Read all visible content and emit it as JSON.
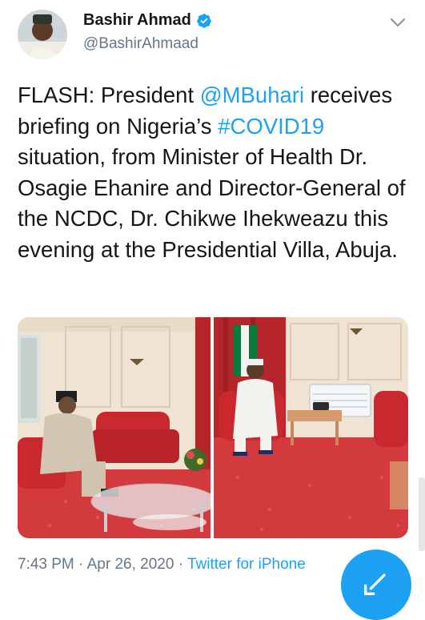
{
  "author": {
    "name": "Bashir Ahmad",
    "handle": "@BashirAhmaad",
    "avatar_icon": "profile-avatar"
  },
  "tweet": {
    "text_parts": [
      "FLASH: President ",
      "@MBuhari",
      " receives briefing on Nigeria’s ",
      "#COVID19",
      " situation, from Minister of Health Dr. Osagie Ehanire and Director-General of the NCDC, Dr. Chikwe Ihekweazu this evening at the Presidential Villa, Abuja."
    ]
  },
  "meta": {
    "time": "7:43 PM",
    "separator1": " · ",
    "date": "Apr 26, 2020",
    "separator2": " · ",
    "source": "Twitter for iPhone"
  },
  "colors": {
    "link": "#1da1f2",
    "secondary": "#657786",
    "text": "#14171a",
    "carpet": "#d23a3e",
    "curtain": "#b5252a"
  },
  "icons": {
    "verified": "verified-badge-icon",
    "chevron": "chevron-down-icon",
    "compose": "compose-tweet-icon"
  }
}
